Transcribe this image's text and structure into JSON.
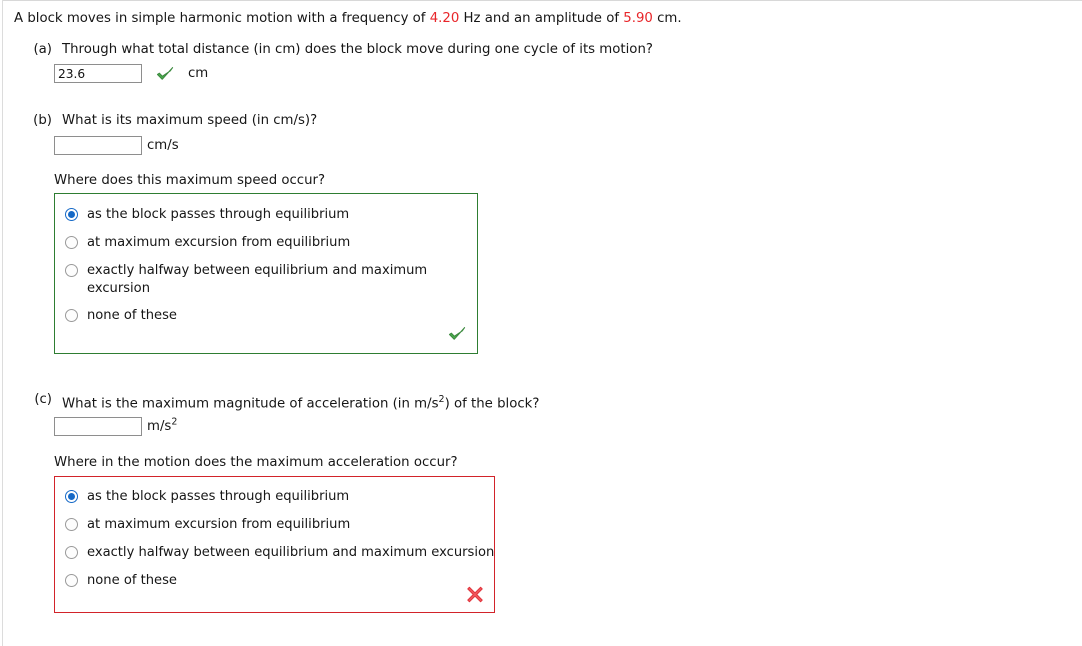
{
  "problem": {
    "stem_prefix": "A block moves in simple harmonic motion with a frequency of ",
    "frequency_value": "4.20",
    "stem_mid": " Hz and an amplitude of ",
    "amplitude_value": "5.90",
    "stem_suffix": " cm.",
    "accent_color": "#e8262a",
    "correct_color": "#2e7d32",
    "incorrect_color": "#d2232a",
    "radio_selected_color": "#1569c7"
  },
  "parts": [
    {
      "label": "(a)",
      "question": "Through what total distance (in cm) does the block move during one cycle of its motion?",
      "input_value": "23.6",
      "input_placeholder": "",
      "unit": "cm",
      "unit_exponent": "",
      "status": "correct",
      "status_icon": "green-check-icon"
    },
    {
      "label": "(b)",
      "question": "What is its maximum speed (in cm/s)?",
      "input_value": "",
      "input_placeholder": "",
      "unit": "cm/s",
      "unit_exponent": "",
      "sub_prompt": "Where does this maximum speed occur?",
      "choice_box_status": "correct",
      "choice_box_icon": "green-check-icon",
      "choices": [
        {
          "label": "as the block passes through equilibrium",
          "selected": true
        },
        {
          "label": "at maximum excursion from equilibrium",
          "selected": false
        },
        {
          "label": "exactly halfway between equilibrium and maximum excursion",
          "selected": false
        },
        {
          "label": "none of these",
          "selected": false
        }
      ]
    },
    {
      "label": "(c)",
      "question_pre": "What is the maximum magnitude of acceleration (in m/s",
      "question_sup": "2",
      "question_post": ") of the block?",
      "input_value": "",
      "input_placeholder": "",
      "unit": "m/s",
      "unit_exponent": "2",
      "sub_prompt": "Where in the motion does the maximum acceleration occur?",
      "choice_box_status": "incorrect",
      "choice_box_icon": "red-x-icon",
      "choices": [
        {
          "label": "as the block passes through equilibrium",
          "selected": true
        },
        {
          "label": "at maximum excursion from equilibrium",
          "selected": false
        },
        {
          "label": "exactly halfway between equilibrium and maximum excursion",
          "selected": false
        },
        {
          "label": "none of these",
          "selected": false
        }
      ]
    }
  ]
}
